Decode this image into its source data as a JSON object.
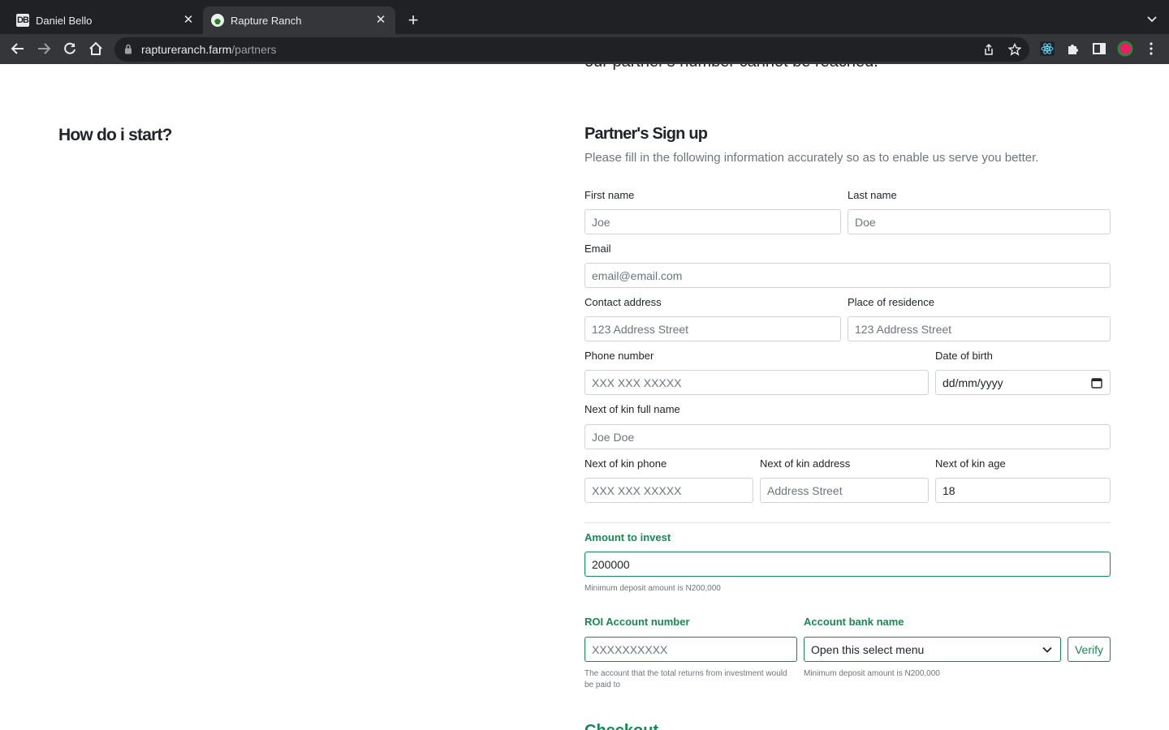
{
  "browser": {
    "tabs": [
      {
        "title": "Daniel Bello",
        "favicon": "DB"
      },
      {
        "title": "Rapture Ranch"
      }
    ],
    "url_host": "raptureranch.farm",
    "url_path": "/partners"
  },
  "page": {
    "cutoff_top_text": "our partner's number cannot be reached.",
    "left_heading": "How do i start?",
    "form_title": "Partner's Sign up",
    "form_subtitle": "Please fill in the following information accurately so as to enable us serve you better.",
    "cutoff_bottom_text": "Checkout"
  },
  "form": {
    "first_name": {
      "label": "First name",
      "placeholder": "Joe"
    },
    "last_name": {
      "label": "Last name",
      "placeholder": "Doe"
    },
    "email": {
      "label": "Email",
      "placeholder": "email@email.com"
    },
    "contact_address": {
      "label": "Contact address",
      "placeholder": "123 Address Street"
    },
    "place_of_residence": {
      "label": "Place of residence",
      "placeholder": "123 Address Street"
    },
    "phone_number": {
      "label": "Phone number",
      "placeholder": "XXX XXX XXXXX"
    },
    "date_of_birth": {
      "label": "Date of birth",
      "placeholder": "dd/mm/yyyy"
    },
    "next_of_kin_name": {
      "label": "Next of kin full name",
      "placeholder": "Joe Doe"
    },
    "next_of_kin_phone": {
      "label": "Next of kin phone",
      "placeholder": "XXX XXX XXXXX"
    },
    "next_of_kin_address": {
      "label": "Next of kin address",
      "placeholder": "Address Street"
    },
    "next_of_kin_age": {
      "label": "Next of kin age",
      "value": "18"
    },
    "amount": {
      "label": "Amount to invest",
      "value": "200000",
      "help": "Minimum deposit amount is N200,000"
    },
    "roi_account": {
      "label": "ROI Account number",
      "placeholder": "XXXXXXXXXX",
      "help": "The account that the total returns from investment would be paid to"
    },
    "bank_name": {
      "label": "Account bank name",
      "selected": "Open this select menu",
      "help": "Minimum deposit amount is N200,000"
    },
    "verify_label": "Verify"
  },
  "colors": {
    "accent": "#198754",
    "chrome_dark": "#202124",
    "chrome_toolbar": "#35363a"
  }
}
